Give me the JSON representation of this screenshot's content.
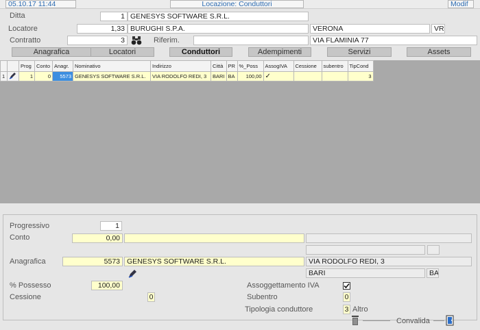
{
  "header": {
    "date_time": "05.10.17 11:44",
    "title": "Locazione: Conduttori",
    "mode": "Modif"
  },
  "form": {
    "ditta": {
      "label": "Ditta",
      "code": "1",
      "name": "GENESYS SOFTWARE S.R.L."
    },
    "locatore": {
      "label": "Locatore",
      "code": "1,33",
      "name": "BURUGHI S.P.A.",
      "city": "VERONA",
      "prov": "VR"
    },
    "contratto": {
      "label": "Contratto",
      "code": "3",
      "riferim_label": "Riferim.",
      "riferim_value": "",
      "address": "VIA FLAMINIA 77"
    }
  },
  "tabs": [
    {
      "label": "Anagrafica"
    },
    {
      "label": "Locatori"
    },
    {
      "label": "Conduttori"
    },
    {
      "label": "Adempimenti"
    },
    {
      "label": "Servizi"
    },
    {
      "label": "Assets"
    }
  ],
  "grid": {
    "columns": [
      "Prog",
      "Conto",
      "Anagr.",
      "Nominativo",
      "Indirizzo",
      "Città",
      "PR",
      "%_Poss",
      "AssogIVA",
      "Cessione",
      "subentro",
      "TipCond"
    ],
    "rows": [
      {
        "row_num": "1",
        "prog": "1",
        "conto": "0",
        "anagr": "5573",
        "nominativo": "GENESYS SOFTWARE S.R.L.",
        "indirizzo": "VIA RODOLFO REDI, 3",
        "citta": "BARI",
        "pr": "BA",
        "poss": "100,00",
        "assog": "✓",
        "cessione": "",
        "subentro": "",
        "tipcond": "3"
      }
    ]
  },
  "detail": {
    "progressivo": {
      "label": "Progressivo",
      "value": "1"
    },
    "conto": {
      "label": "Conto",
      "value": "0,00",
      "desc": ""
    },
    "anagrafica": {
      "label": "Anagrafica",
      "code": "5573",
      "name": "GENESYS SOFTWARE S.R.L.",
      "address": "VIA RODOLFO REDI, 3",
      "city": "BARI",
      "prov": "BA"
    },
    "possesso": {
      "label": "% Possesso",
      "value": "100,00"
    },
    "cessione": {
      "label": "Cessione",
      "value": "0"
    },
    "assoggettamento": {
      "label": "Assoggettamento IVA",
      "checked": true
    },
    "subentro": {
      "label": "Subentro",
      "value": "0"
    },
    "tipologia": {
      "label": "Tipologia conduttore",
      "value": "3",
      "desc": "Altro"
    },
    "convalida_label": "Convalida"
  }
}
